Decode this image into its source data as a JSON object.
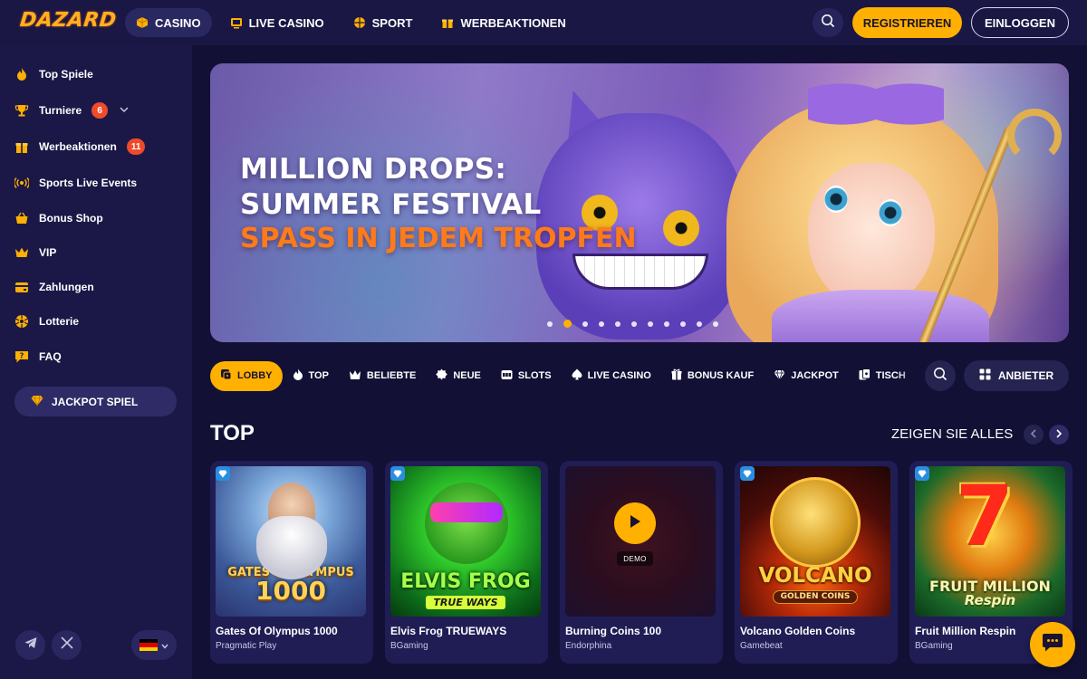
{
  "brand": {
    "logo_text": "DAZARD",
    "accent": "#ffb000"
  },
  "header": {
    "nav": [
      {
        "label": "CASINO",
        "icon": "cube-icon",
        "active": true
      },
      {
        "label": "LIVE CASINO",
        "icon": "live-tv-icon"
      },
      {
        "label": "SPORT",
        "icon": "ball-icon"
      },
      {
        "label": "WERBEAKTIONEN",
        "icon": "gift-icon"
      }
    ],
    "register_label": "REGISTRIEREN",
    "login_label": "EINLOGGEN"
  },
  "sidebar": {
    "items": [
      {
        "label": "Top Spiele",
        "icon": "flame-icon"
      },
      {
        "label": "Turniere",
        "icon": "trophy-icon",
        "badge": "6"
      },
      {
        "label": "Werbeaktionen",
        "icon": "gift-icon",
        "badge": "11"
      },
      {
        "label": "Sports Live Events",
        "icon": "broadcast-icon"
      },
      {
        "label": "Bonus Shop",
        "icon": "basket-icon"
      },
      {
        "label": "VIP",
        "icon": "crown-icon"
      },
      {
        "label": "Zahlungen",
        "icon": "wallet-icon"
      },
      {
        "label": "Lotterie",
        "icon": "lottery-icon"
      },
      {
        "label": "FAQ",
        "icon": "faq-icon"
      }
    ],
    "jackpot_label": "JACKPOT SPIEL",
    "social": [
      "telegram-icon",
      "x-icon"
    ],
    "language": "de"
  },
  "banner": {
    "title_line1": "MILLION DROPS:",
    "title_line2": "SUMMER FESTIVAL",
    "subtitle": "SPASS IN JEDEM TROPFEN",
    "slide_count": 11,
    "active_slide": 2
  },
  "categories": {
    "tabs": [
      {
        "label": "LOBBY",
        "icon": "dice-icon",
        "active": true
      },
      {
        "label": "TOP",
        "icon": "flame-icon"
      },
      {
        "label": "BELIEBTE",
        "icon": "crown-icon"
      },
      {
        "label": "NEUE",
        "icon": "new-icon"
      },
      {
        "label": "SLOTS",
        "icon": "slot-icon"
      },
      {
        "label": "LIVE CASINO",
        "icon": "spade-icon"
      },
      {
        "label": "BONUS KAUF",
        "icon": "bonus-icon"
      },
      {
        "label": "JACKPOT",
        "icon": "diamond-icon"
      },
      {
        "label": "TISCH",
        "icon": "cards-icon"
      }
    ],
    "providers_label": "ANBIETER"
  },
  "section": {
    "title": "TOP",
    "see_all_label": "ZEIGEN SIE ALLES"
  },
  "games": [
    {
      "name": "Gates Of Olympus 1000",
      "provider": "Pragmatic Play",
      "art_line1": "GATES of OLYMPUS",
      "art_line2": "1000"
    },
    {
      "name": "Elvis Frog TRUEWAYS",
      "provider": "BGaming",
      "art_line1": "ELVIS FROG",
      "art_line2": "TRUE WAYS"
    },
    {
      "name": "Burning Coins 100",
      "provider": "Endorphina",
      "demo_label": "DEMO"
    },
    {
      "name": "Volcano Golden Coins",
      "provider": "Gamebeat",
      "art_line1": "VOLCANO",
      "art_line2": "GOLDEN COINS"
    },
    {
      "name": "Fruit Million Respin",
      "provider": "BGaming",
      "art_line1": "FRUIT MILLION",
      "art_line2": "Respin"
    }
  ]
}
